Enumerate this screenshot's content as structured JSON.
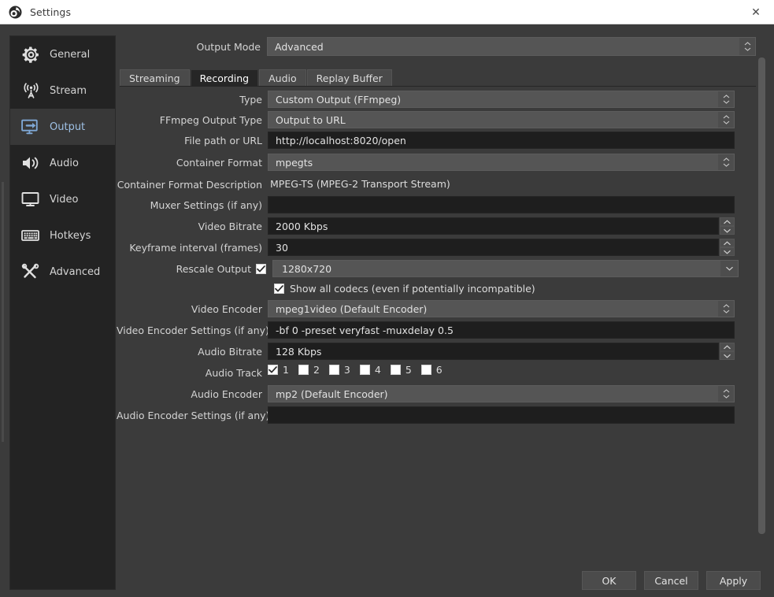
{
  "window": {
    "title": "Settings",
    "icon": "obs-logo-icon",
    "close_label": "✕"
  },
  "sidebar": {
    "items": [
      {
        "label": "General",
        "icon": "gear-icon",
        "selected": false
      },
      {
        "label": "Stream",
        "icon": "broadcast-icon",
        "selected": false
      },
      {
        "label": "Output",
        "icon": "output-icon",
        "selected": true
      },
      {
        "label": "Audio",
        "icon": "speaker-icon",
        "selected": false
      },
      {
        "label": "Video",
        "icon": "monitor-icon",
        "selected": false
      },
      {
        "label": "Hotkeys",
        "icon": "keyboard-icon",
        "selected": false
      },
      {
        "label": "Advanced",
        "icon": "tools-icon",
        "selected": false
      }
    ]
  },
  "output_mode": {
    "label": "Output Mode",
    "value": "Advanced"
  },
  "tabs": [
    {
      "label": "Streaming",
      "active": false
    },
    {
      "label": "Recording",
      "active": true
    },
    {
      "label": "Audio",
      "active": false
    },
    {
      "label": "Replay Buffer",
      "active": false
    }
  ],
  "fields": {
    "type": {
      "label": "Type",
      "value": "Custom Output (FFmpeg)"
    },
    "ffmpeg_output_type": {
      "label": "FFmpeg Output Type",
      "value": "Output to URL"
    },
    "file_path_or_url": {
      "label": "File path or URL",
      "value": "http://localhost:8020/open"
    },
    "container_format": {
      "label": "Container Format",
      "value": "mpegts"
    },
    "container_format_description": {
      "label": "Container Format Description",
      "value": "MPEG-TS (MPEG-2 Transport Stream)"
    },
    "muxer_settings": {
      "label": "Muxer Settings (if any)",
      "value": ""
    },
    "video_bitrate": {
      "label": "Video Bitrate",
      "value": "2000 Kbps"
    },
    "keyframe_interval": {
      "label": "Keyframe interval (frames)",
      "value": "30"
    },
    "rescale_output": {
      "label": "Rescale Output",
      "value": "1280x720",
      "checked": true
    },
    "show_all_codecs": {
      "label": "Show all codecs (even if potentially incompatible)",
      "checked": true
    },
    "video_encoder": {
      "label": "Video Encoder",
      "value": "mpeg1video (Default Encoder)"
    },
    "video_encoder_settings": {
      "label": "Video Encoder Settings (if any)",
      "value": "-bf 0 -preset veryfast -muxdelay 0.5"
    },
    "audio_bitrate": {
      "label": "Audio Bitrate",
      "value": "128 Kbps"
    },
    "audio_track": {
      "label": "Audio Track",
      "tracks": [
        {
          "number": "1",
          "checked": true
        },
        {
          "number": "2",
          "checked": false
        },
        {
          "number": "3",
          "checked": false
        },
        {
          "number": "4",
          "checked": false
        },
        {
          "number": "5",
          "checked": false
        },
        {
          "number": "6",
          "checked": false
        }
      ]
    },
    "audio_encoder": {
      "label": "Audio Encoder",
      "value": "mp2 (Default Encoder)"
    },
    "audio_encoder_settings": {
      "label": "Audio Encoder Settings (if any)",
      "value": ""
    }
  },
  "footer": {
    "ok": "OK",
    "cancel": "Cancel",
    "apply": "Apply"
  },
  "colors": {
    "accent": "#9ec0e4",
    "window_bg": "#3b3b3b",
    "sidebar_bg": "#232323",
    "input_bg": "#1e1e1e",
    "combo_bg": "#555555",
    "titlebar_bg": "#ffffff"
  }
}
